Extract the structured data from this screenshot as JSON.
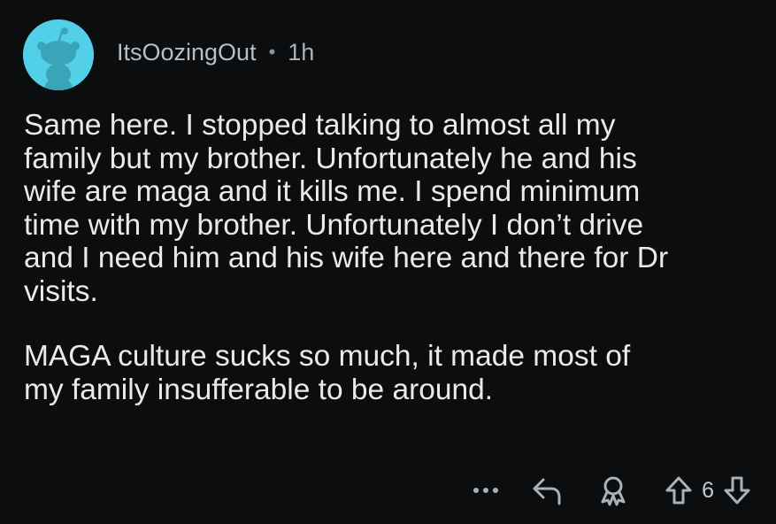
{
  "comment": {
    "author": "ItsOozingOut",
    "separator": "•",
    "timestamp": "1h",
    "paragraphs": [
      "Same here. I stopped talking to almost all my\nfamily but my brother. Unfortunately he and his\nwife are maga and it kills me. I spend minimum\ntime with my brother. Unfortunately I don’t drive\nand I need him and his wife here and there for Dr\nvisits.",
      "MAGA culture sucks so much, it made most of\nmy family insufferable to be around."
    ]
  },
  "actions": {
    "more_icon": "more-dots-icon",
    "reply_icon": "reply-arrow-icon",
    "award_icon": "award-icon",
    "upvote_icon": "upvote-arrow-icon",
    "downvote_icon": "downvote-arrow-icon",
    "vote_count": "6"
  },
  "colors": {
    "background": "#0b0d0f",
    "avatar": "#52d0e8",
    "text": "#e8eaec",
    "muted": "#aab2b8"
  }
}
